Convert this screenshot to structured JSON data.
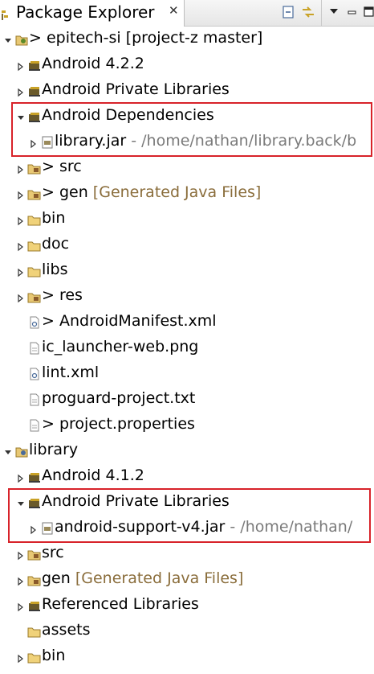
{
  "view": {
    "title": "Package Explorer",
    "close_glyph": "✕",
    "toolbar": [
      {
        "name": "collapse-all-icon"
      },
      {
        "name": "link-with-editor-icon"
      },
      {
        "name": "view-menu-icon"
      },
      {
        "name": "minimize-icon"
      },
      {
        "name": "maximize-icon"
      }
    ]
  },
  "colors": {
    "highlight_box": "#d8232a",
    "decoration_brown": "#8a6d3b",
    "decoration_grey": "#7a7a7a"
  },
  "tree": [
    {
      "depth": 0,
      "arrow": "expanded",
      "icon": "android-project-icon",
      "prefix": "> ",
      "label": "epitech-si [project-z master]",
      "decoration": "",
      "deco_style": ""
    },
    {
      "depth": 1,
      "arrow": "collapsed",
      "icon": "library-container-icon",
      "prefix": "",
      "label": "Android 4.2.2",
      "decoration": "",
      "deco_style": ""
    },
    {
      "depth": 1,
      "arrow": "collapsed",
      "icon": "library-container-icon",
      "prefix": "",
      "label": "Android Private Libraries",
      "decoration": "",
      "deco_style": ""
    },
    {
      "depth": 1,
      "arrow": "expanded",
      "icon": "library-container-icon",
      "prefix": "",
      "label": "Android Dependencies",
      "decoration": "",
      "deco_style": ""
    },
    {
      "depth": 2,
      "arrow": "collapsed",
      "icon": "jar-file-icon",
      "prefix": "",
      "label": "library.jar",
      "decoration": " - /home/nathan/library.back/b",
      "deco_style": "grey"
    },
    {
      "depth": 1,
      "arrow": "collapsed",
      "icon": "source-folder-icon",
      "prefix": "> ",
      "label": "src",
      "decoration": "",
      "deco_style": ""
    },
    {
      "depth": 1,
      "arrow": "collapsed",
      "icon": "source-folder-icon",
      "prefix": "> ",
      "label": "gen",
      "decoration": " [Generated Java Files]",
      "deco_style": "brown"
    },
    {
      "depth": 1,
      "arrow": "collapsed",
      "icon": "folder-icon",
      "prefix": "",
      "label": "bin",
      "decoration": "",
      "deco_style": ""
    },
    {
      "depth": 1,
      "arrow": "collapsed",
      "icon": "folder-icon",
      "prefix": "",
      "label": "doc",
      "decoration": "",
      "deco_style": ""
    },
    {
      "depth": 1,
      "arrow": "collapsed",
      "icon": "folder-icon",
      "prefix": "",
      "label": "libs",
      "decoration": "",
      "deco_style": ""
    },
    {
      "depth": 1,
      "arrow": "collapsed",
      "icon": "source-folder-icon",
      "prefix": "> ",
      "label": "res",
      "decoration": "",
      "deco_style": ""
    },
    {
      "depth": 1,
      "arrow": "none",
      "icon": "xml-file-icon",
      "prefix": "> ",
      "label": "AndroidManifest.xml",
      "decoration": "",
      "deco_style": ""
    },
    {
      "depth": 1,
      "arrow": "none",
      "icon": "file-icon",
      "prefix": "",
      "label": "ic_launcher-web.png",
      "decoration": "",
      "deco_style": ""
    },
    {
      "depth": 1,
      "arrow": "none",
      "icon": "xml-file-icon",
      "prefix": "",
      "label": "lint.xml",
      "decoration": "",
      "deco_style": ""
    },
    {
      "depth": 1,
      "arrow": "none",
      "icon": "file-icon",
      "prefix": "",
      "label": "proguard-project.txt",
      "decoration": "",
      "deco_style": ""
    },
    {
      "depth": 1,
      "arrow": "none",
      "icon": "file-icon",
      "prefix": "> ",
      "label": "project.properties",
      "decoration": "",
      "deco_style": ""
    },
    {
      "depth": 0,
      "arrow": "expanded",
      "icon": "library-project-icon",
      "prefix": "",
      "label": "library",
      "decoration": "",
      "deco_style": ""
    },
    {
      "depth": 1,
      "arrow": "collapsed",
      "icon": "library-container-icon",
      "prefix": "",
      "label": "Android 4.1.2",
      "decoration": "",
      "deco_style": ""
    },
    {
      "depth": 1,
      "arrow": "expanded",
      "icon": "library-container-icon",
      "prefix": "",
      "label": "Android Private Libraries",
      "decoration": "",
      "deco_style": ""
    },
    {
      "depth": 2,
      "arrow": "collapsed",
      "icon": "jar-file-icon",
      "prefix": "",
      "label": "android-support-v4.jar",
      "decoration": " - /home/nathan/",
      "deco_style": "grey"
    },
    {
      "depth": 1,
      "arrow": "collapsed",
      "icon": "source-folder-icon",
      "prefix": "",
      "label": "src",
      "decoration": "",
      "deco_style": ""
    },
    {
      "depth": 1,
      "arrow": "collapsed",
      "icon": "source-folder-icon",
      "prefix": "",
      "label": "gen",
      "decoration": " [Generated Java Files]",
      "deco_style": "brown"
    },
    {
      "depth": 1,
      "arrow": "collapsed",
      "icon": "library-container-icon",
      "prefix": "",
      "label": "Referenced Libraries",
      "decoration": "",
      "deco_style": ""
    },
    {
      "depth": 1,
      "arrow": "none",
      "icon": "folder-icon",
      "prefix": "",
      "label": "assets",
      "decoration": "",
      "deco_style": ""
    },
    {
      "depth": 1,
      "arrow": "collapsed",
      "icon": "folder-icon",
      "prefix": "",
      "label": "bin",
      "decoration": "",
      "deco_style": ""
    }
  ],
  "highlights": [
    {
      "name": "highlight-android-dependencies",
      "from_row": 3,
      "to_row": 4
    },
    {
      "name": "highlight-android-private-libraries",
      "from_row": 18,
      "to_row": 19
    }
  ]
}
